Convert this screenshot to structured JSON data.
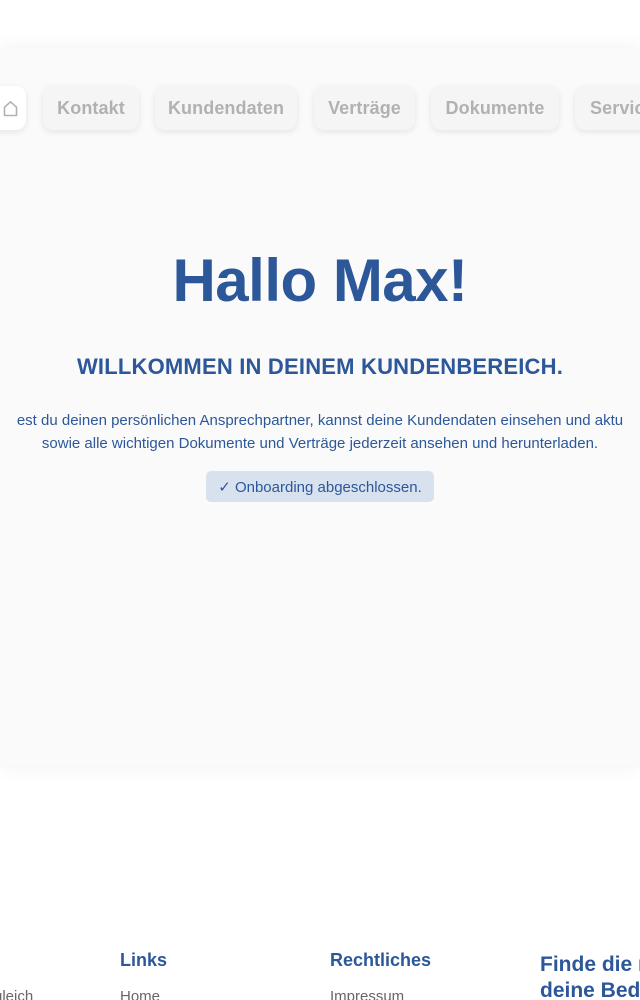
{
  "nav": {
    "home_icon": "home-icon",
    "items": [
      {
        "label": "Kontakt"
      },
      {
        "label": "Kundendaten"
      },
      {
        "label": "Verträge"
      },
      {
        "label": "Dokumente"
      },
      {
        "label": "Servic"
      }
    ]
  },
  "hero": {
    "greeting": "Hallo Max!",
    "subtitle": "WILLKOMMEN IN DEINEM KUNDENBEREICH.",
    "description_line1": "est du deinen persönlichen Ansprechpartner, kannst deine Kundendaten einsehen und aktu",
    "description_line2": "sowie alle wichtigen Dokumente und Verträge jederzeit ansehen und herunterladen.",
    "status_badge": "✓ Onboarding abgeschlossen."
  },
  "footer": {
    "left_cut_link": "gleich",
    "links": {
      "heading": "Links",
      "first_item": "Home"
    },
    "legal": {
      "heading": "Rechtliches",
      "first_item": "Impressum"
    },
    "cta": {
      "line1": "Finde die r",
      "line2": "deine Bed"
    }
  },
  "colors": {
    "brand_blue": "#2c5799",
    "nav_text": "#b1b1b1",
    "panel_bg": "#fafafa",
    "badge_bg": "#d8e2ef"
  }
}
